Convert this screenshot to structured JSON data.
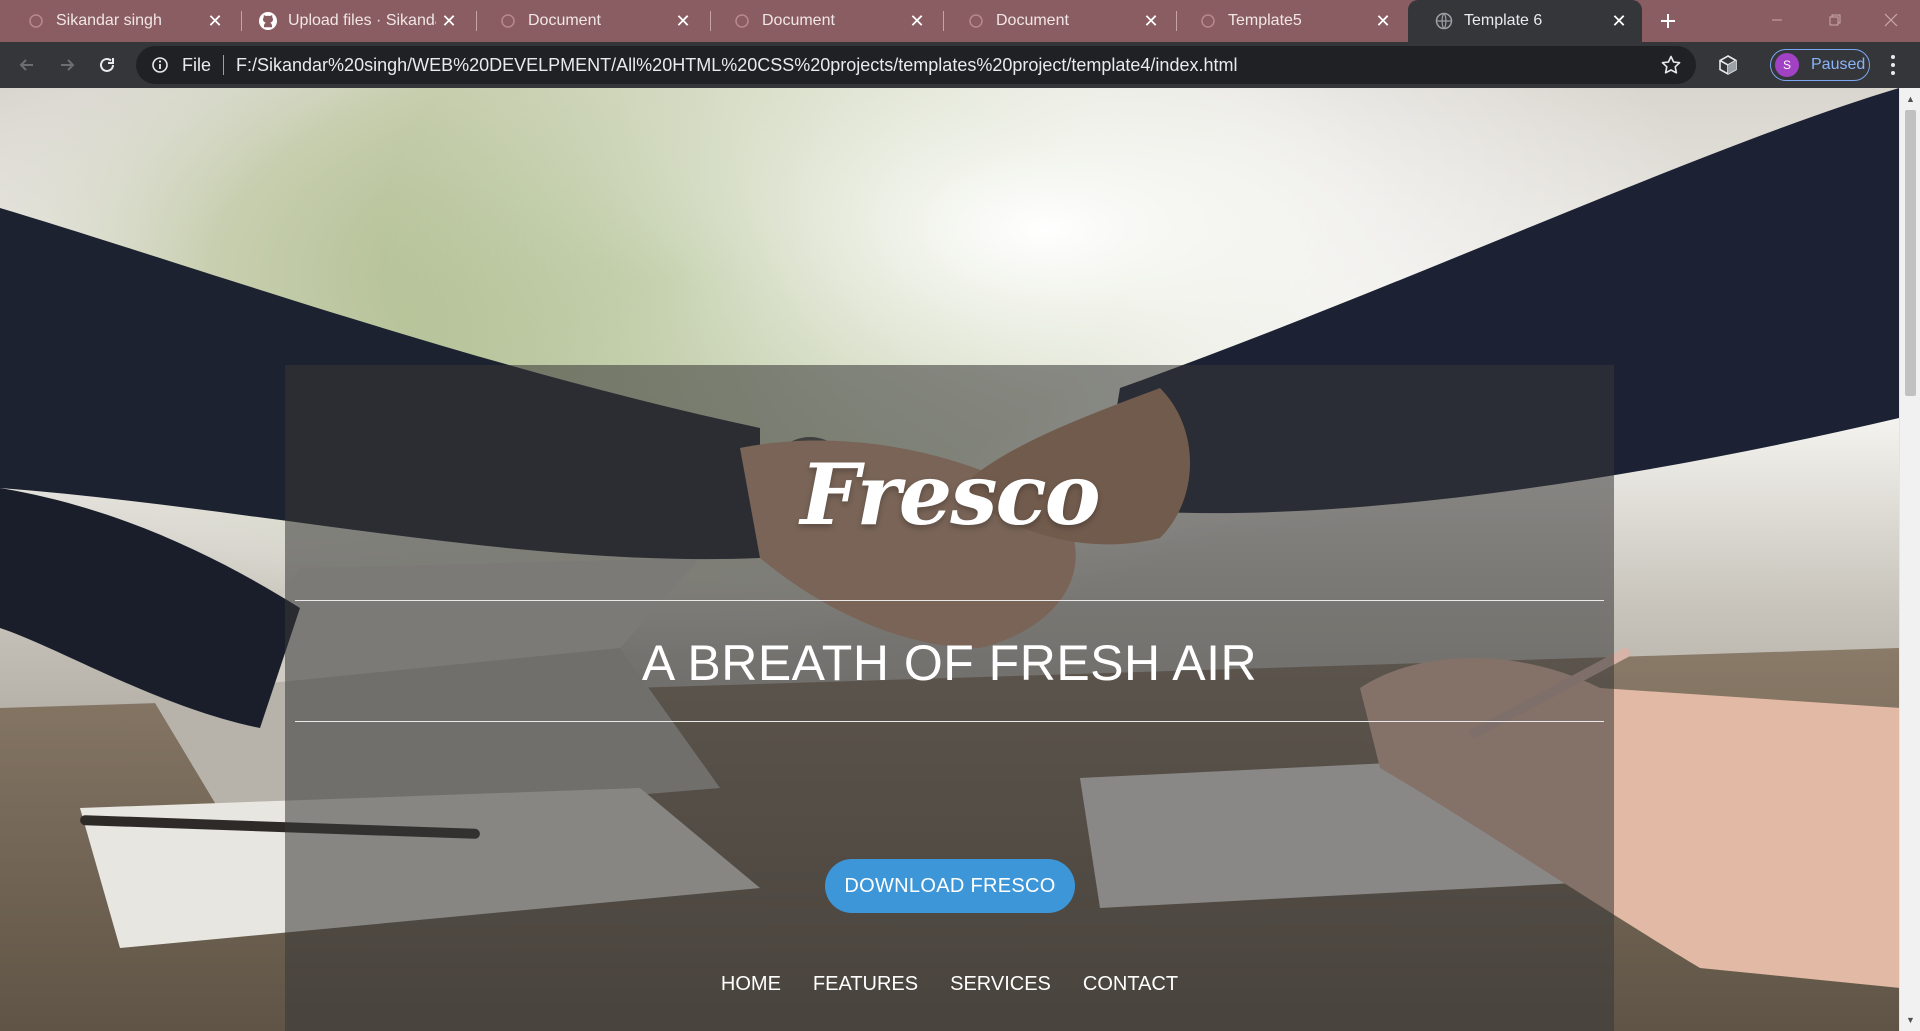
{
  "browser": {
    "tabs": [
      {
        "title": "Sikandar singh",
        "icon": "page-icon",
        "active": false
      },
      {
        "title": "Upload files · Sikandars",
        "icon": "github-icon",
        "active": false
      },
      {
        "title": "Document",
        "icon": "page-icon",
        "active": false
      },
      {
        "title": "Document",
        "icon": "page-icon",
        "active": false
      },
      {
        "title": "Document",
        "icon": "page-icon",
        "active": false
      },
      {
        "title": "Template5",
        "icon": "page-icon",
        "active": false
      },
      {
        "title": "Template 6",
        "icon": "globe-icon",
        "active": true
      }
    ],
    "address": {
      "scheme": "File",
      "url": "F:/Sikandar%20singh/WEB%20DEVELPMENT/All%20HTML%20CSS%20projects/templates%20project/template4/index.html"
    },
    "profile": {
      "initial": "S",
      "status": "Paused"
    }
  },
  "page": {
    "brand": "Fresco",
    "tagline": "A BREATH OF FRESH AIR",
    "cta_label": "DOWNLOAD FRESCO",
    "nav": [
      "HOME",
      "FEATURES",
      "SERVICES",
      "CONTACT"
    ]
  },
  "colors": {
    "tabstrip": "#8a5d62",
    "toolbar": "#35363a",
    "cta": "#3d96d8",
    "profile_border": "#7aa7f0"
  }
}
